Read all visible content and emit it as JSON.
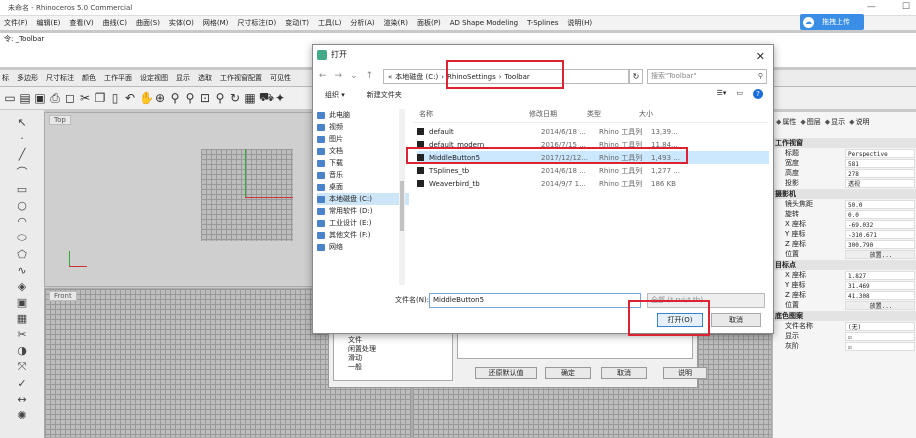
{
  "window": {
    "title": "未命名 - Rhinoceros 5.0 Commercial"
  },
  "menu": {
    "items": [
      "文件(F)",
      "编辑(E)",
      "查看(V)",
      "曲线(C)",
      "曲面(S)",
      "实体(O)",
      "网格(M)",
      "尺寸标注(D)",
      "变动(T)",
      "工具(L)",
      "分析(A)",
      "渲染(R)",
      "面板(P)",
      "AD Shape Modeling",
      "T-Splines",
      "说明(H)"
    ]
  },
  "cloud": {
    "label": "拖拽上传"
  },
  "command": {
    "line1": "令: _Toolbar"
  },
  "toolbar_tabs": {
    "items": [
      "标",
      "多边形",
      "尺寸标注",
      "颜色",
      "工作平面",
      "设定视图",
      "显示",
      "选取",
      "工作视窗配置",
      "可见性"
    ]
  },
  "viewports": {
    "top": "Top",
    "front": "Front"
  },
  "dialog": {
    "title": "打开",
    "close": "✕",
    "breadcrumb": [
      "«",
      "本地磁盘 (C:)",
      "›",
      "RhinoSettings",
      "›",
      "Toolbar"
    ],
    "search_placeholder": "搜索\"Toolbar\"",
    "organize": "组织 ▾",
    "new_folder": "新建文件夹",
    "nav": [
      "此电脑",
      "视频",
      "图片",
      "文档",
      "下载",
      "音乐",
      "桌面",
      "本地磁盘 (C:)",
      "常用软件 (D:)",
      "工业设计 (E:)",
      "其他文件 (F:)",
      "网络"
    ],
    "nav_selected": 7,
    "columns": [
      "名称",
      "修改日期",
      "类型",
      "大小"
    ],
    "files": [
      [
        "default",
        "2014/6/18 ...",
        "Rhino 工具列",
        "13,39..."
      ],
      [
        "default_modern",
        "2016/7/15 ...",
        "Rhino 工具列",
        "11,84..."
      ],
      [
        "MiddleButton5",
        "2017/12/12...",
        "Rhino 工具列",
        "1,493 ..."
      ],
      [
        "TSplines_tb",
        "2014/6/18 ...",
        "Rhino 工具列",
        "1,277 ..."
      ],
      [
        "Weaverbird_tb",
        "2014/9/7 1...",
        "Rhino 工具列",
        "186 KB"
      ]
    ],
    "selected_file": 2,
    "filename_label": "文件名(N):",
    "filename_value": "MiddleButton5",
    "filetype": "全部 (*.rui;*.tb)",
    "open_button": "打开(O)",
    "cancel_button": "取消"
  },
  "bg_dialog": {
    "tree": [
      "文件",
      "闲置处理",
      "滑动",
      "一般"
    ],
    "buttons": [
      "还原默认值",
      "确定",
      "取消",
      "说明"
    ]
  },
  "right_panel": {
    "tabs": [
      "属性",
      "图层",
      "显示",
      "说明"
    ],
    "sections": [
      "工作视窗",
      "摄影机",
      "目标点",
      "底色图案"
    ],
    "viewport": [
      [
        "标题",
        "Perspective"
      ],
      [
        "宽度",
        "581"
      ],
      [
        "高度",
        "278"
      ],
      [
        "投影",
        "透视"
      ]
    ],
    "camera": [
      [
        "镜头焦距",
        "50.0"
      ],
      [
        "旋转",
        "0.0"
      ],
      [
        "X 座标",
        "-69.032"
      ],
      [
        "Y 座标",
        "-310.671"
      ],
      [
        "Z 座标",
        "300.790"
      ],
      [
        "位置",
        "放置..."
      ]
    ],
    "target": [
      [
        "X 座标",
        "1.827"
      ],
      [
        "Y 座标",
        "31.469"
      ],
      [
        "Z 座标",
        "41.308"
      ],
      [
        "位置",
        "放置..."
      ]
    ],
    "wallpaper": [
      [
        "文件名称",
        "(无)"
      ],
      [
        "显示",
        "☑"
      ],
      [
        "灰阶",
        "☑"
      ]
    ]
  },
  "colors": {
    "accent": "#3a8ee6",
    "highlight_red": "#d22233",
    "selection": "#cce8ff"
  }
}
